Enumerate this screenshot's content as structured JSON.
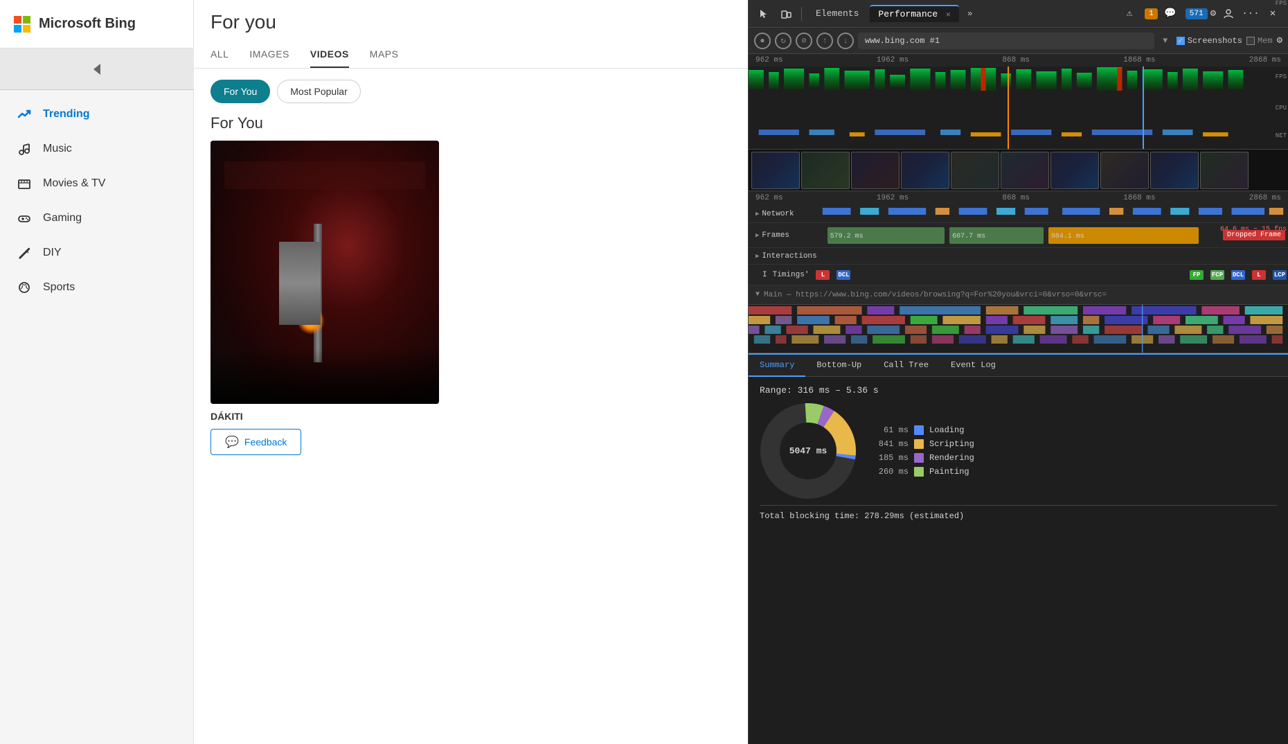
{
  "brand": {
    "name": "Microsoft Bing"
  },
  "search": {
    "query": "For you",
    "tabs": [
      {
        "label": "ALL",
        "active": false
      },
      {
        "label": "IMAGES",
        "active": false
      },
      {
        "label": "VIDEOS",
        "active": true
      },
      {
        "label": "MAPS",
        "active": false
      }
    ]
  },
  "filter_pills": [
    {
      "label": "For You",
      "active": true
    },
    {
      "label": "Most Popular",
      "active": false
    }
  ],
  "section_title": "For You",
  "video": {
    "artist": "DÁKITI",
    "feedback_label": "Feedback"
  },
  "sidebar": {
    "items": [
      {
        "label": "Trending",
        "active": true,
        "icon": "📈"
      },
      {
        "label": "Music",
        "active": false,
        "icon": "🎵"
      },
      {
        "label": "Movies & TV",
        "active": false,
        "icon": "🎬"
      },
      {
        "label": "Gaming",
        "active": false,
        "icon": "🎮"
      },
      {
        "label": "DIY",
        "active": false,
        "icon": "🔧"
      },
      {
        "label": "Sports",
        "active": false,
        "icon": "⚡"
      }
    ]
  },
  "devtools": {
    "tab_elements": "Elements",
    "tab_performance": "Performance",
    "warning_count": "1",
    "info_count": "571",
    "url": "www.bing.com #1",
    "screenshots_label": "Screenshots",
    "memory_label": "Mem",
    "time_markers": [
      "962 ms",
      "1962 ms",
      "868 ms",
      "1868 ms",
      "2868 ms"
    ],
    "time_markers_2": [
      "962 ms",
      "1962 ms",
      "868 ms",
      "1868 ms",
      "2868 ms"
    ],
    "fps_label": "FPS",
    "cpu_label": "CPU",
    "net_label": "NET",
    "track_network": "Network",
    "track_frames": "Frames",
    "frame_times": [
      "579.2 ms",
      "607.7 ms",
      "984.1 ms"
    ],
    "track_interactions": "Interactions",
    "timing_labels": [
      "L",
      "DCL",
      "FP",
      "FCP",
      "DCL",
      "L",
      "LCP"
    ],
    "main_url": "Main — https://www.bing.com/videos/browsing?q=For%20you&vrci=0&vrso=0&vrsc=",
    "dropped_fps": "64.6 ms ~ 15 fps",
    "dropped_label": "Dropped Frame",
    "summary_tabs": [
      "Summary",
      "Bottom-Up",
      "Call Tree",
      "Event Log"
    ],
    "summary_range": "Range: 316 ms – 5.36 s",
    "donut_total": "5047 ms",
    "legend": [
      {
        "ms": "61 ms",
        "label": "Loading",
        "color": "#5588ff"
      },
      {
        "ms": "841 ms",
        "label": "Scripting",
        "color": "#e8b84b"
      },
      {
        "ms": "185 ms",
        "label": "Rendering",
        "color": "#9966cc"
      },
      {
        "ms": "260 ms",
        "label": "Painting",
        "color": "#99cc66"
      }
    ],
    "total_blocking": "Total blocking time: 278.29ms (estimated)"
  }
}
